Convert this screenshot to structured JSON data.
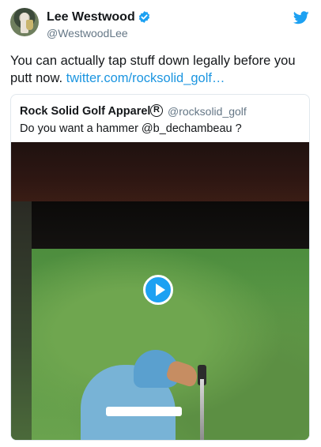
{
  "author": {
    "name": "Lee Westwood",
    "handle": "@WestwoodLee",
    "verified": true
  },
  "tweet": {
    "text": "You can actually tap stuff down legally before you putt now.",
    "link": "twitter.com/rocksolid_golf…"
  },
  "quoted": {
    "name": "Rock Solid Golf Apparel",
    "reg_symbol": "R",
    "handle": "@rocksolid_golf",
    "text": "Do you want a hammer @b_dechambeau ?"
  },
  "icons": {
    "verified": "verified-badge-icon",
    "bird": "twitter-bird-icon",
    "play": "play-icon"
  },
  "colors": {
    "link": "#1b95e0",
    "accent": "#1da1f2",
    "secondary_text": "#657786"
  }
}
